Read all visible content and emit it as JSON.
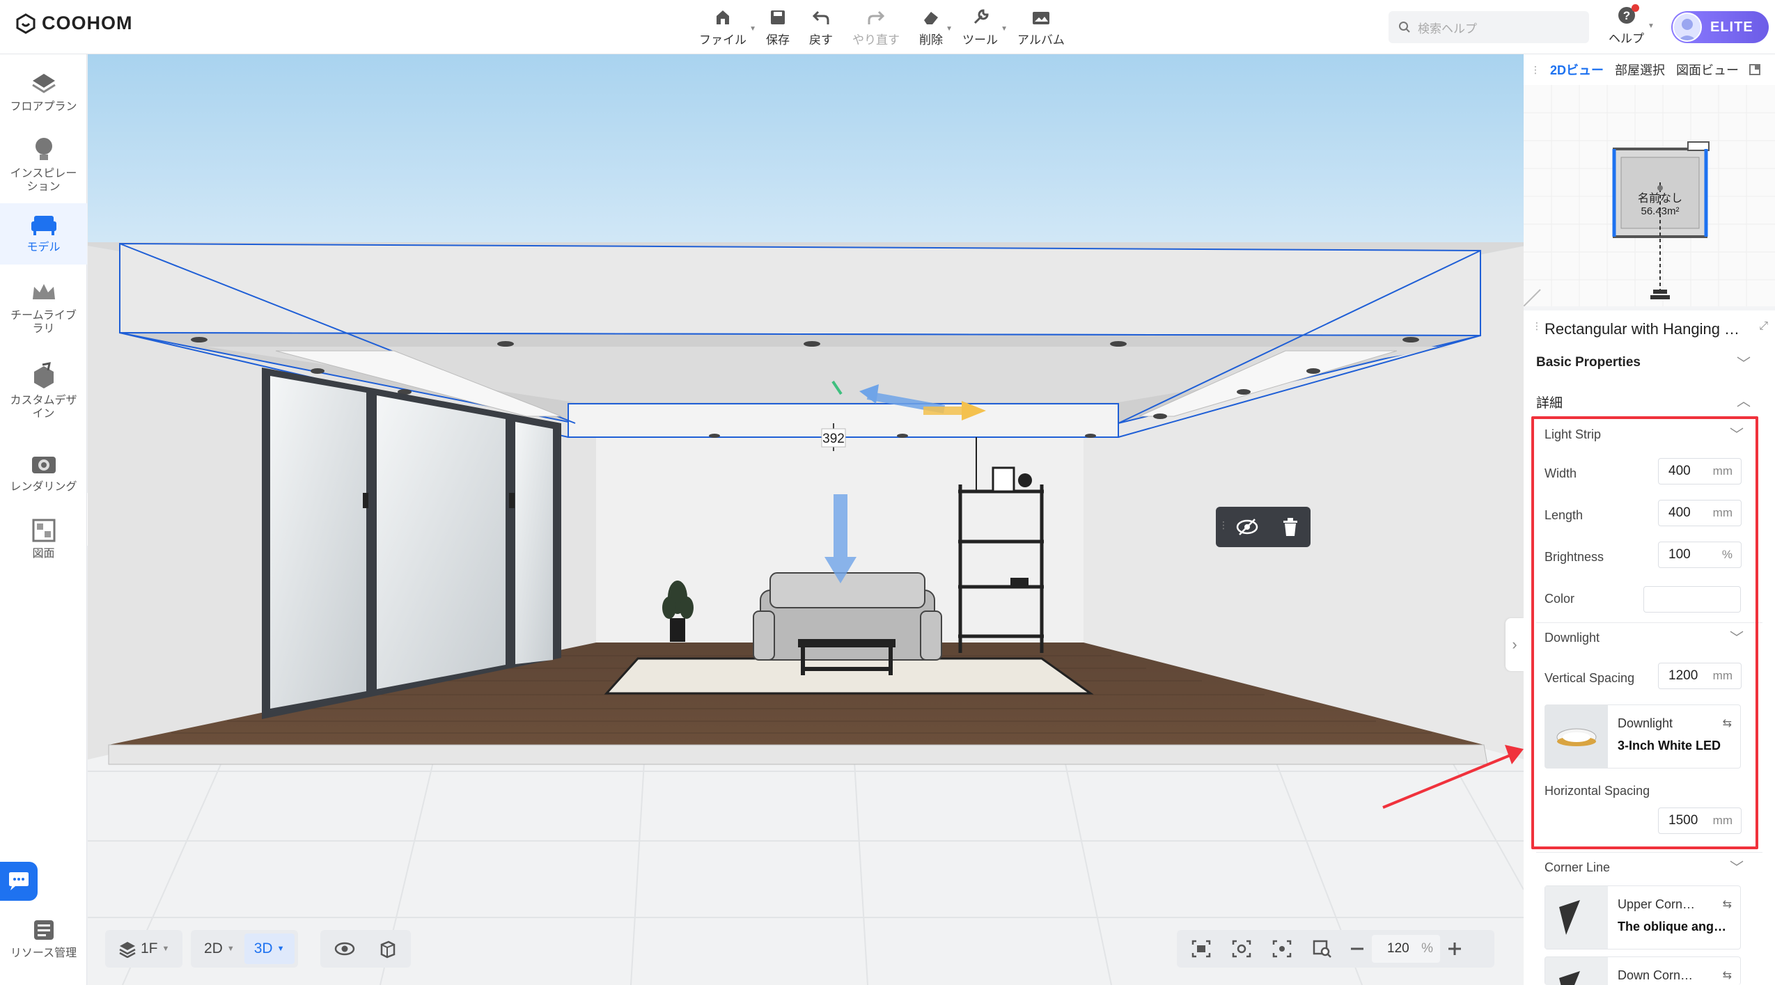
{
  "app": {
    "name": "COOHOM"
  },
  "toolbar": {
    "file": "ファイル",
    "save": "保存",
    "undo": "戻す",
    "redo": "やり直す",
    "delete": "削除",
    "tools": "ツール",
    "album": "アルバム"
  },
  "search": {
    "placeholder": "検索ヘルプ"
  },
  "help": {
    "label": "ヘルプ"
  },
  "user": {
    "badge": "ELITE"
  },
  "sidebar": {
    "items": [
      {
        "label": "フロアプラン"
      },
      {
        "label": "インスピレーション"
      },
      {
        "label": "モデル"
      },
      {
        "label": "チームライブラリ"
      },
      {
        "label": "カスタムデザイン"
      },
      {
        "label": "レンダリング"
      },
      {
        "label": "図面"
      }
    ],
    "resource": "リソース管理"
  },
  "viewport": {
    "dimension_label": "392"
  },
  "bottombar": {
    "floor": "1F",
    "view2d": "2D",
    "view3d": "3D",
    "zoom": "120",
    "zoom_unit": "%"
  },
  "minimap": {
    "tabs": [
      "2Dビュー",
      "部屋選択",
      "図面ビュー"
    ],
    "room_name": "名前なし",
    "room_area": "56.43m²"
  },
  "panel": {
    "title": "Rectangular with Hanging …",
    "basic": "Basic Properties",
    "detail": "詳細",
    "light_strip": {
      "title": "Light Strip",
      "width_label": "Width",
      "width": "400",
      "width_unit": "mm",
      "length_label": "Length",
      "length": "400",
      "length_unit": "mm",
      "brightness_label": "Brightness",
      "brightness": "100",
      "brightness_unit": "%",
      "color_label": "Color"
    },
    "downlight": {
      "title": "Downlight",
      "vspacing_label": "Vertical Spacing",
      "vspacing": "1200",
      "vspacing_unit": "mm",
      "card_type": "Downlight",
      "card_name": "3-Inch White LED",
      "hspacing_label": "Horizontal Spacing",
      "hspacing": "1500",
      "hspacing_unit": "mm"
    },
    "corner_line": {
      "title": "Corner Line",
      "card1_type": "Upper Corn…",
      "card1_name": "The oblique ang…",
      "card2_type": "Down Corn…"
    }
  },
  "colors": {
    "accent": "#1e72f0",
    "highlight": "#f0323c"
  }
}
